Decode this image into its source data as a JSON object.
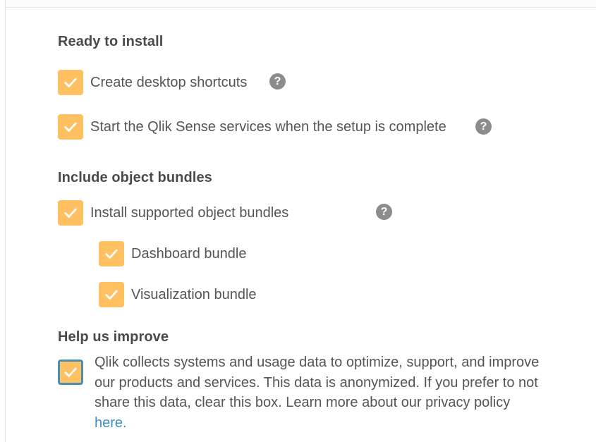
{
  "sections": {
    "ready": {
      "title": "Ready to install",
      "options": [
        {
          "label": "Create desktop shortcuts",
          "checked": true,
          "help_icon": "question-circle-icon"
        },
        {
          "label": "Start the Qlik Sense services when the setup is complete",
          "checked": true,
          "help_icon": "question-circle-icon"
        }
      ]
    },
    "bundles": {
      "title": "Include object bundles",
      "main": {
        "label": "Install supported object bundles",
        "checked": true,
        "help_icon": "question-circle-icon"
      },
      "children": [
        {
          "label": "Dashboard bundle",
          "checked": true
        },
        {
          "label": "Visualization bundle",
          "checked": true
        }
      ]
    },
    "improve": {
      "title": "Help us improve",
      "consent_checked": true,
      "consent_text": "Qlik collects systems and usage data to optimize, support, and improve our products and services. This data is anonymized. If you prefer to not share this data, clear this box. Learn more about our privacy policy ",
      "link_text": "here."
    }
  },
  "help_glyph": "?",
  "colors": {
    "checkbox": "#ffc062",
    "checkmark": "#ffffff",
    "focus_ring": "#4a8fb8",
    "link": "#3b8fc4",
    "help_icon": "#8c8c8c",
    "text": "#555555",
    "heading": "#4a4a4a"
  }
}
